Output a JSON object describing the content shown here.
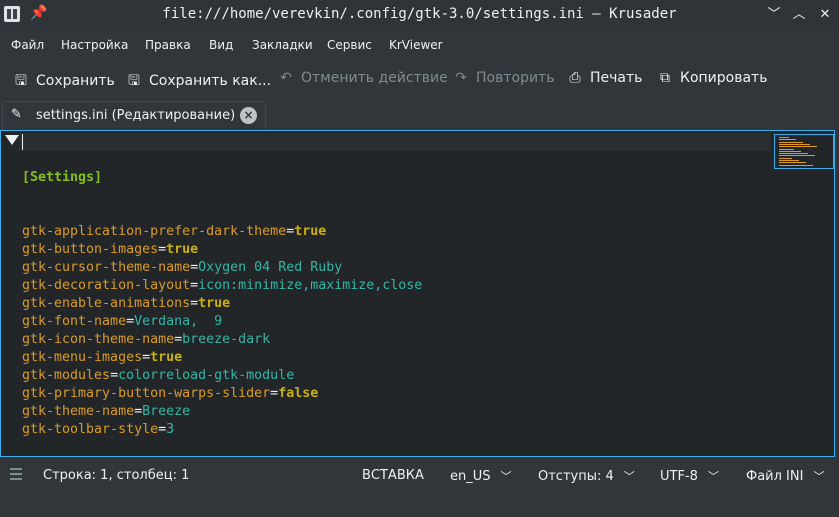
{
  "window": {
    "title": "file:///home/verevkin/.config/gtk-3.0/settings.ini — Krusader"
  },
  "menu": [
    "Файл",
    "Настройка",
    "Правка",
    "Вид",
    "Закладки",
    "Сервис",
    "KrViewer"
  ],
  "toolbar": {
    "save": "Сохранить",
    "save_as": "Сохранить как...",
    "undo": "Отменить действие",
    "redo": "Повторить",
    "print": "Печать",
    "copy": "Копировать"
  },
  "tab": {
    "label": "settings.ini (Редактирование)"
  },
  "editor": {
    "section": "[Settings]",
    "lines": [
      {
        "key": "gtk-application-prefer-dark-theme",
        "value": "true",
        "bool": true
      },
      {
        "key": "gtk-button-images",
        "value": "true",
        "bool": true
      },
      {
        "key": "gtk-cursor-theme-name",
        "value": "Oxygen 04 Red Ruby",
        "bool": false
      },
      {
        "key": "gtk-decoration-layout",
        "value": "icon:minimize,maximize,close",
        "bool": false
      },
      {
        "key": "gtk-enable-animations",
        "value": "true",
        "bool": true
      },
      {
        "key": "gtk-font-name",
        "value": "Verdana,  9",
        "bool": false
      },
      {
        "key": "gtk-icon-theme-name",
        "value": "breeze-dark",
        "bool": false
      },
      {
        "key": "gtk-menu-images",
        "value": "true",
        "bool": true
      },
      {
        "key": "gtk-modules",
        "value": "colorreload-gtk-module",
        "bool": false
      },
      {
        "key": "gtk-primary-button-warps-slider",
        "value": "false",
        "bool": true
      },
      {
        "key": "gtk-theme-name",
        "value": "Breeze",
        "bool": false
      },
      {
        "key": "gtk-toolbar-style",
        "value": "3",
        "bool": false
      }
    ]
  },
  "status": {
    "position": "Строка: 1, столбец: 1",
    "mode": "ВСТАВКА",
    "language": "en_US",
    "indent": "Отступы: 4",
    "encoding": "UTF-8",
    "filetype": "Файл INI"
  },
  "colors": {
    "key": "#da9b2a",
    "value": "#35b5a6",
    "keyword": "#c9b012",
    "section": "#85c01a",
    "focus": "#3daee9"
  }
}
